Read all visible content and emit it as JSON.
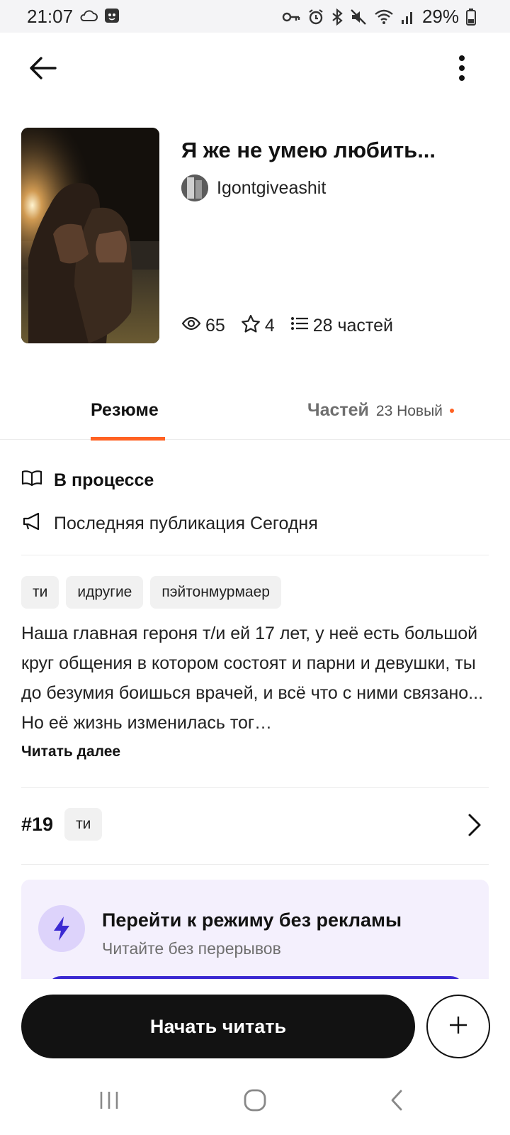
{
  "status_bar": {
    "time": "21:07",
    "battery": "29%",
    "icons": [
      "cloud-icon",
      "app-notification-icon",
      "key-icon",
      "alarm-icon",
      "bluetooth-icon",
      "mute-icon",
      "wifi-icon",
      "signal-icon",
      "battery-icon"
    ]
  },
  "app_bar": {
    "back_icon": "arrow-left-icon",
    "more_icon": "more-vertical-icon"
  },
  "story": {
    "title": "Я же не умею любить...",
    "author": "Igontgiveashit",
    "views": "65",
    "votes": "4",
    "parts": "28 частей"
  },
  "tabs": {
    "summary": "Резюме",
    "parts_label": "Частей",
    "parts_count": "23 Новый",
    "accent": "#ff6122"
  },
  "info": {
    "status": "В процессе",
    "last_published": "Последняя публикация Сегодня"
  },
  "tags": [
    "ти",
    "идругие",
    "пэйтонмурмаер"
  ],
  "description": "Наша главная героня т/и ей 17 лет, у неё есть большой круг общения в котором состоят и парни и девушки, ты до безумия боишься врачей, и всё что с ними связано... Но её жизнь изменилась тог…",
  "read_more": "Читать далее",
  "ranking": {
    "rank": "#19",
    "tag": "ти"
  },
  "promo": {
    "title": "Перейти к режиму без рекламы",
    "subtitle": "Читайте без перерывов",
    "icon": "lightning-icon",
    "accent": "#3b2ad2"
  },
  "actions": {
    "start_reading": "Начать читать",
    "add_icon": "plus-icon"
  },
  "system_nav": [
    "recent-apps-icon",
    "home-icon",
    "back-nav-icon"
  ]
}
